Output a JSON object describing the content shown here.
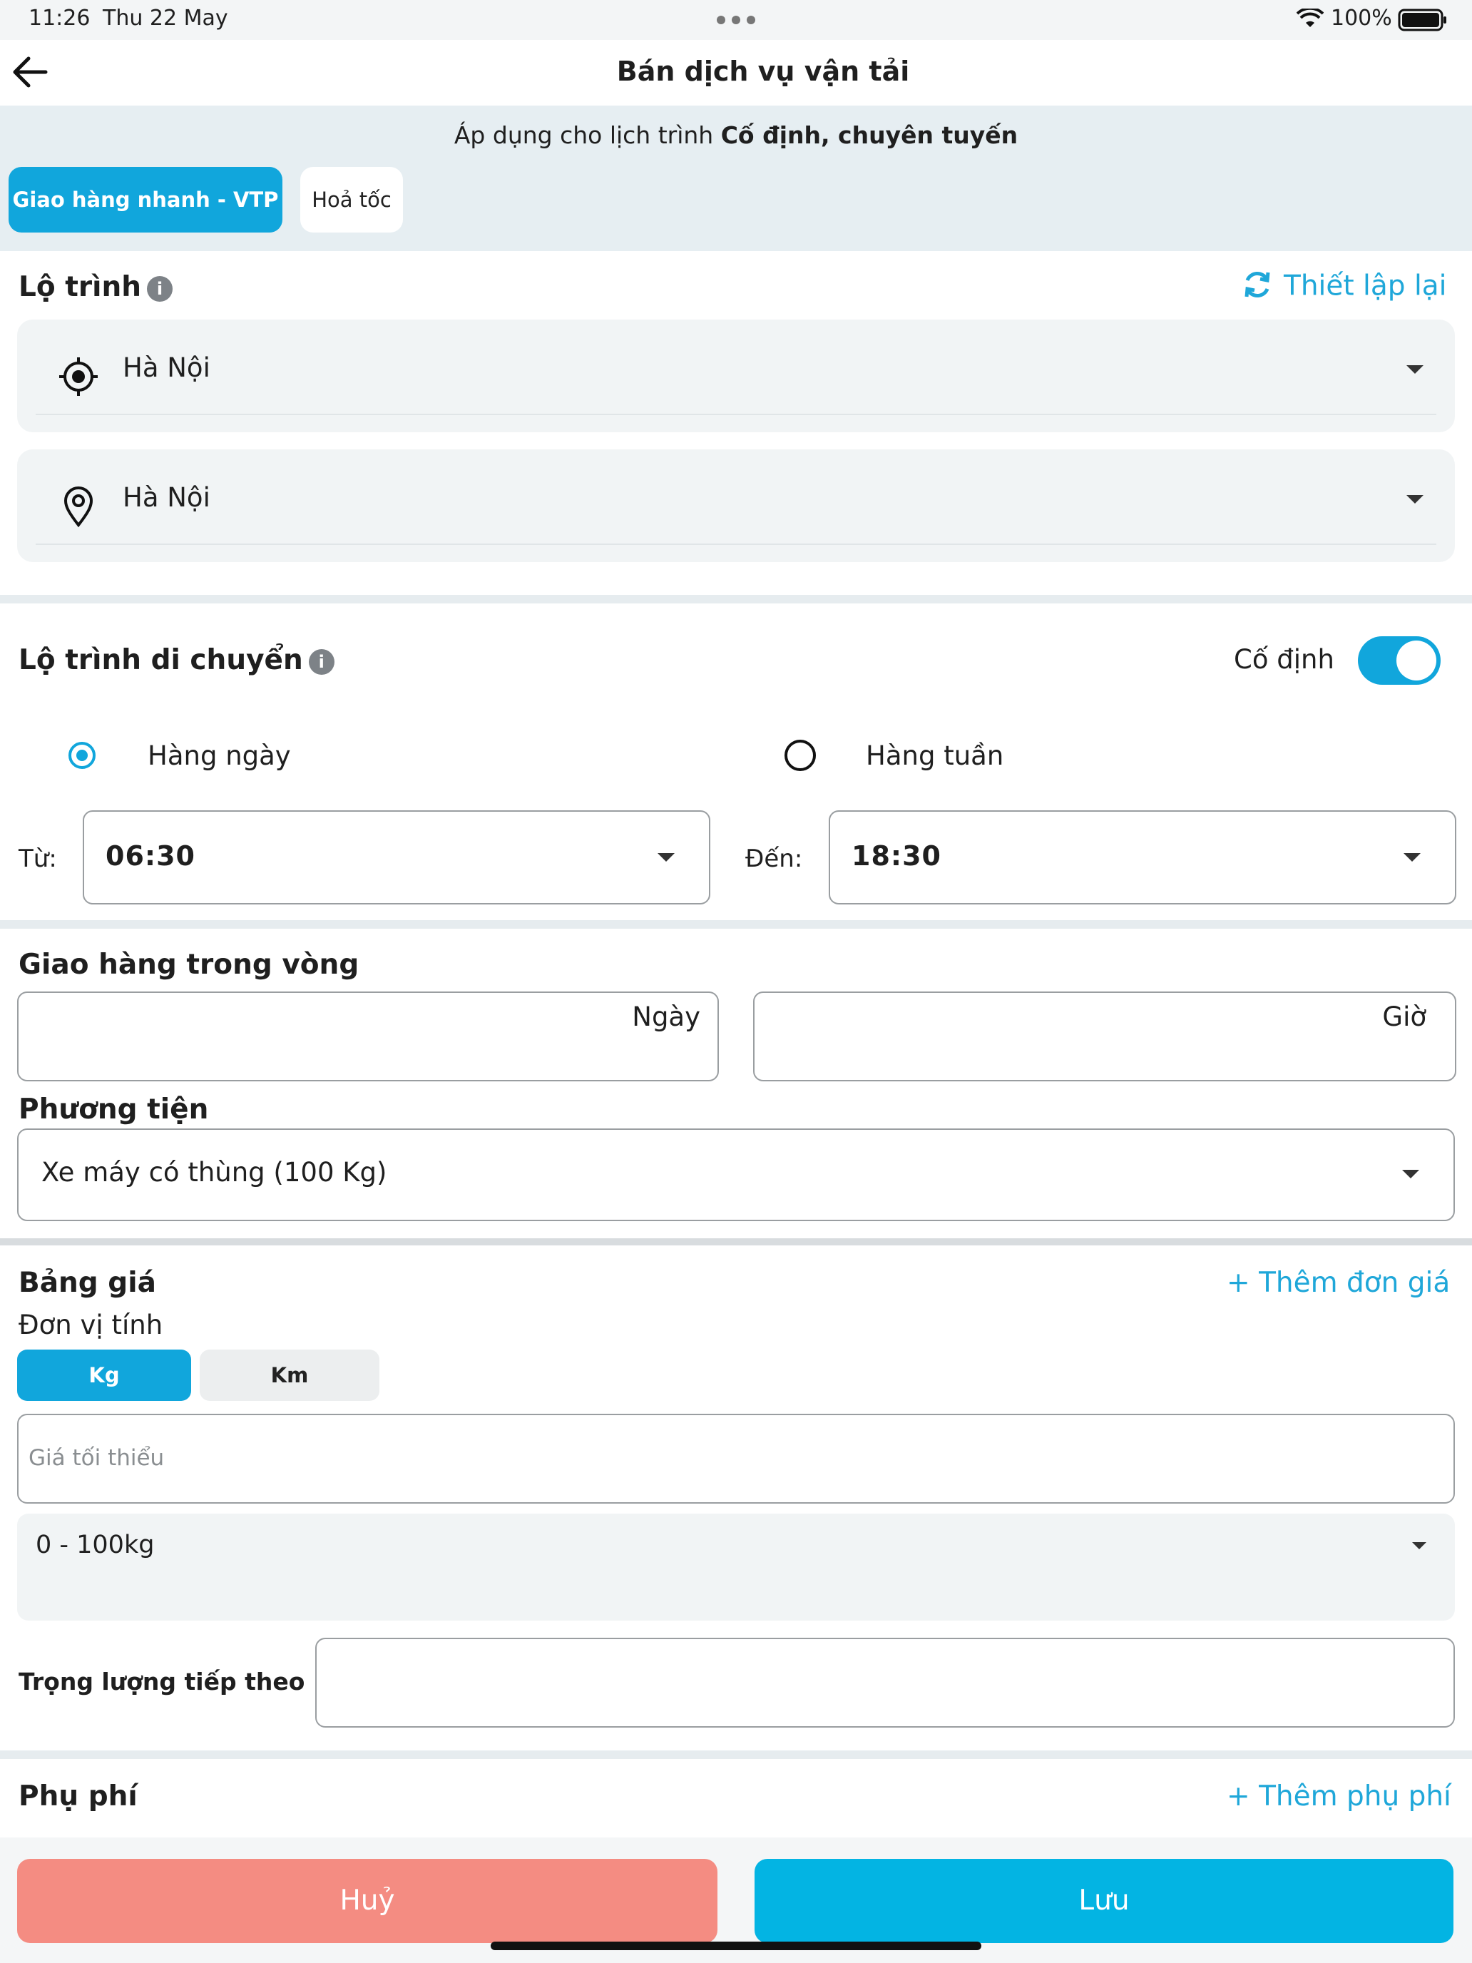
{
  "status_bar": {
    "time": "11:26",
    "date": "Thu 22 May",
    "battery": "100%"
  },
  "header": {
    "title": "Bán dịch vụ vận tải"
  },
  "banner": {
    "text_prefix": "Áp dụng cho lịch trình ",
    "text_bold": "Cố định, chuyên tuyến",
    "tabs": [
      {
        "label": "Giao hàng nhanh - VTP",
        "selected": true
      },
      {
        "label": "Hoả tốc",
        "selected": false
      }
    ]
  },
  "route": {
    "title": "Lộ trình",
    "reset_label": "Thiết lập lại",
    "origin": "Hà Nội",
    "destination": "Hà Nội"
  },
  "movement": {
    "title": "Lộ trình di chuyển",
    "fixed_label": "Cố định",
    "fixed_on": true,
    "daily_label": "Hàng ngày",
    "weekly_label": "Hàng tuần",
    "selected": "daily",
    "from_label": "Từ:",
    "from_value": "06:30",
    "to_label": "Đến:",
    "to_value": "18:30"
  },
  "delivery": {
    "title": "Giao hàng trong vòng",
    "day_suffix": "Ngày",
    "hour_suffix": "Giờ"
  },
  "vehicle": {
    "title": "Phương tiện",
    "value": "Xe máy có thùng (100 Kg)"
  },
  "pricing": {
    "title": "Bảng giá",
    "add_label": "+ Thêm đơn giá",
    "unit_label": "Đơn vị tính",
    "units": [
      {
        "label": "Kg",
        "selected": true
      },
      {
        "label": "Km",
        "selected": false
      }
    ],
    "min_price_placeholder": "Giá tối thiểu",
    "range_value": "0 - 100kg",
    "next_weight_label": "Trọng lượng tiếp theo"
  },
  "surcharge": {
    "title": "Phụ phí",
    "add_label": "+ Thêm phụ phí"
  },
  "footer": {
    "cancel_label": "Huỷ",
    "save_label": "Lưu"
  },
  "colors": {
    "accent": "#11a6dc",
    "cancel": "#f48c82",
    "save": "#03b4e3"
  }
}
